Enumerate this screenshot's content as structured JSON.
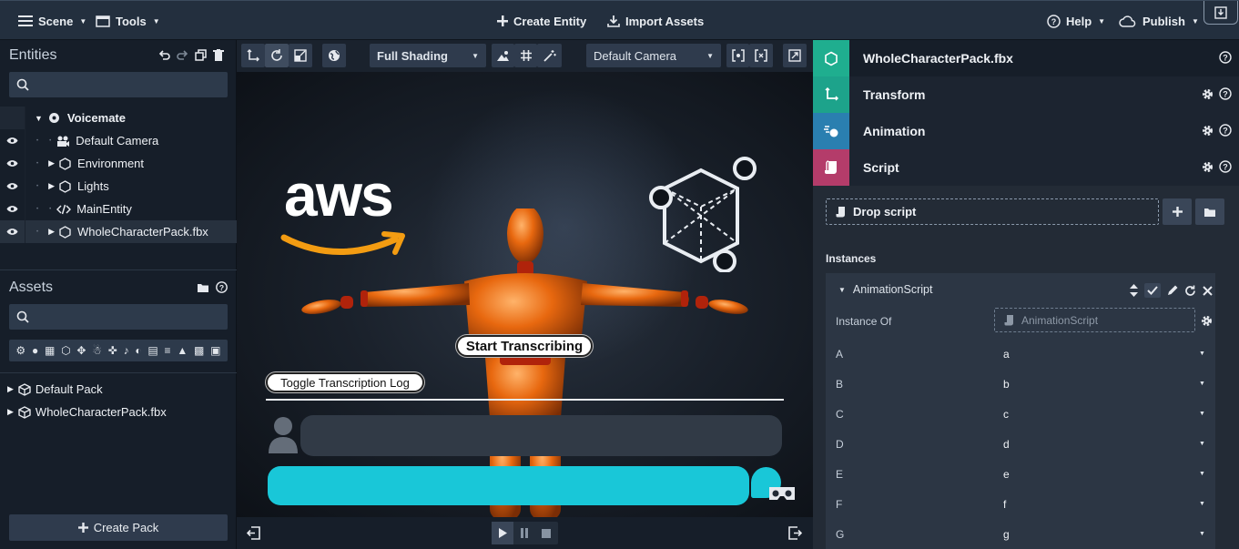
{
  "topbar": {
    "scene_label": "Scene",
    "tools_label": "Tools",
    "create_entity_label": "Create Entity",
    "import_assets_label": "Import Assets",
    "help_label": "Help",
    "publish_label": "Publish"
  },
  "entities": {
    "title": "Entities",
    "search_placeholder": "",
    "tree": {
      "root": "Voicemate",
      "items": [
        {
          "label": "Default Camera",
          "icon": "camera-icon"
        },
        {
          "label": "Environment",
          "icon": "hexagon-icon"
        },
        {
          "label": "Lights",
          "icon": "hexagon-icon"
        },
        {
          "label": "MainEntity",
          "icon": "code-icon"
        },
        {
          "label": "WholeCharacterPack.fbx",
          "icon": "hexagon-icon"
        }
      ]
    }
  },
  "assets": {
    "title": "Assets",
    "search_placeholder": "",
    "packs": [
      "Default Pack",
      "WholeCharacterPack.fbx"
    ],
    "create_pack_label": "Create Pack"
  },
  "viewport": {
    "shading_label": "Full Shading",
    "camera_label": "Default Camera",
    "start_transcribing_label": "Start Transcribing",
    "toggle_log_label": "Toggle Transcription Log",
    "aws_logo_text": "aws"
  },
  "inspector": {
    "entity_name": "WholeCharacterPack.fbx",
    "components": [
      {
        "name": "Transform",
        "color": "#1da38b"
      },
      {
        "name": "Animation",
        "color": "#2a7fb0"
      },
      {
        "name": "Script",
        "color": "#b43c6a"
      }
    ],
    "entity_color": "#1fae8f",
    "drop_script_label": "Drop script",
    "instances_label": "Instances",
    "instance": {
      "name": "AnimationScript",
      "instance_of_label": "Instance Of",
      "instance_of_value": "AnimationScript",
      "attributes": [
        {
          "label": "A",
          "value": "a"
        },
        {
          "label": "B",
          "value": "b"
        },
        {
          "label": "C",
          "value": "c"
        },
        {
          "label": "D",
          "value": "d"
        },
        {
          "label": "E",
          "value": "e"
        },
        {
          "label": "F",
          "value": "f"
        },
        {
          "label": "G",
          "value": "g"
        }
      ]
    }
  },
  "colors": {
    "topbar_bg": "#232f3e",
    "panel_bg": "#161e29",
    "aws_orange": "#f39c12",
    "chat_input": "#19c7d8"
  }
}
